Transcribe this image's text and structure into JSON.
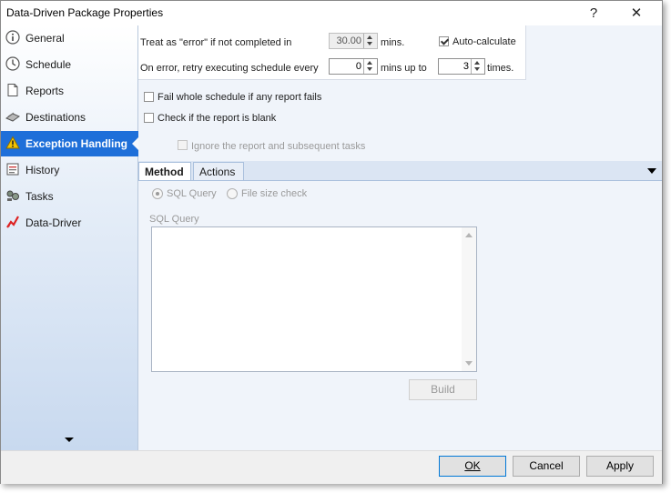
{
  "window": {
    "title": "Data-Driven Package Properties",
    "help_label": "?",
    "close_label": "✕"
  },
  "sidebar": {
    "items": [
      {
        "label": "General",
        "icon": "info-icon"
      },
      {
        "label": "Schedule",
        "icon": "clock-icon"
      },
      {
        "label": "Reports",
        "icon": "document-icon"
      },
      {
        "label": "Destinations",
        "icon": "destinations-icon"
      },
      {
        "label": "Exception Handling",
        "icon": "warning-icon",
        "active": true
      },
      {
        "label": "History",
        "icon": "history-icon"
      },
      {
        "label": "Tasks",
        "icon": "tasks-icon"
      },
      {
        "label": "Data-Driver",
        "icon": "data-driver-icon"
      }
    ],
    "accent_color": "#1e6fd9"
  },
  "error_settings": {
    "treat_label": "Treat as \"error\" if not completed in",
    "treat_value": "30.00",
    "mins_label": "mins.",
    "auto_calculate_label": "Auto-calculate",
    "auto_calculate_checked": true,
    "retry_label": "On error, retry  executing schedule every",
    "retry_value": "0",
    "mins_up_to_label": "mins up to",
    "times_value": "3",
    "times_label": "times."
  },
  "options": {
    "fail_whole_label": "Fail whole schedule if any report fails",
    "check_blank_label": "Check if the report is blank",
    "ignore_label": "Ignore the report and subsequent tasks"
  },
  "tabs": {
    "method_label": "Method",
    "actions_label": "Actions"
  },
  "method": {
    "sql_query_radio": "SQL Query",
    "file_size_radio": "File size check",
    "sql_query_label": "SQL Query",
    "sql_query_value": "",
    "build_label": "Build"
  },
  "footer": {
    "ok_label": "OK",
    "cancel_label": "Cancel",
    "apply_label": "Apply"
  }
}
